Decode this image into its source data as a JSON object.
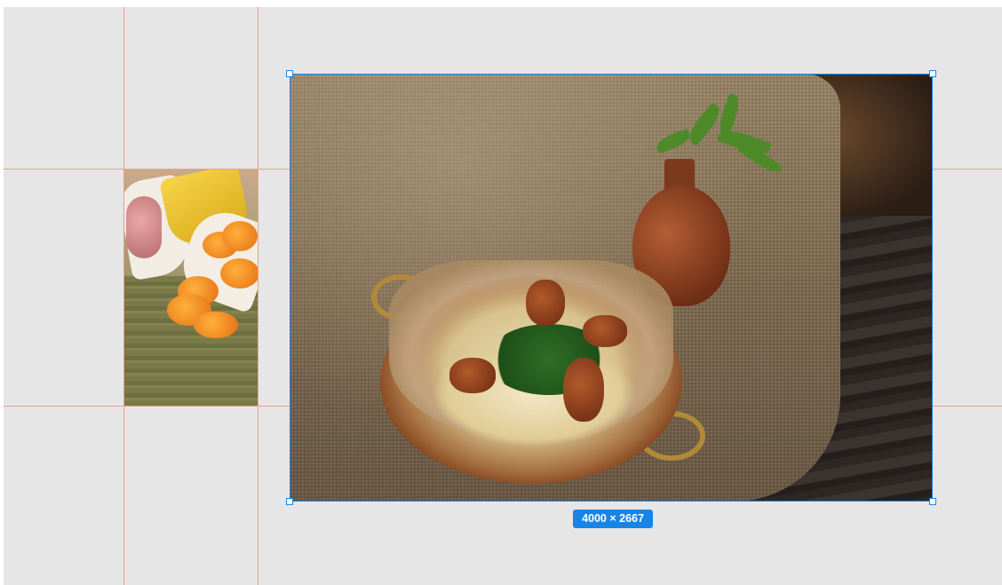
{
  "canvas": {
    "background_color": "#e6e6e6",
    "guide_color": "#e7a08f",
    "selection_color": "#1d86e8"
  },
  "images": [
    {
      "name": "chips-thumbnail",
      "selected": false
    },
    {
      "name": "pasta-shrimp-photo",
      "selected": true
    }
  ],
  "selection": {
    "dimensions_label": "4000 × 2667"
  }
}
